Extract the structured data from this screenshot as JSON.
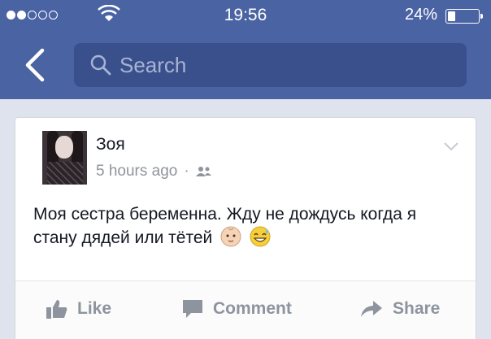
{
  "status_bar": {
    "time": "19:56",
    "battery_percent": "24%",
    "battery_level": 0.24,
    "signal_bars_filled": 2,
    "signal_bars_total": 5
  },
  "nav": {
    "back_icon": "chevron-left-icon",
    "search_icon": "search-icon",
    "search_placeholder": "Search"
  },
  "post": {
    "author": "Зоя",
    "time_ago": "5 hours ago",
    "separator": "·",
    "audience_icon": "friends-icon",
    "text": "Моя сестра беременна. Жду не дождусь когда я стану дядей или тётей",
    "emojis": [
      "baby-face-icon",
      "grinning-sweat-icon"
    ],
    "options_icon": "chevron-down-icon"
  },
  "actions": {
    "like_label": "Like",
    "comment_label": "Comment",
    "share_label": "Share"
  },
  "colors": {
    "header_bg": "#4a63a3",
    "search_bg": "#39508c",
    "action_text": "#8d949e"
  }
}
